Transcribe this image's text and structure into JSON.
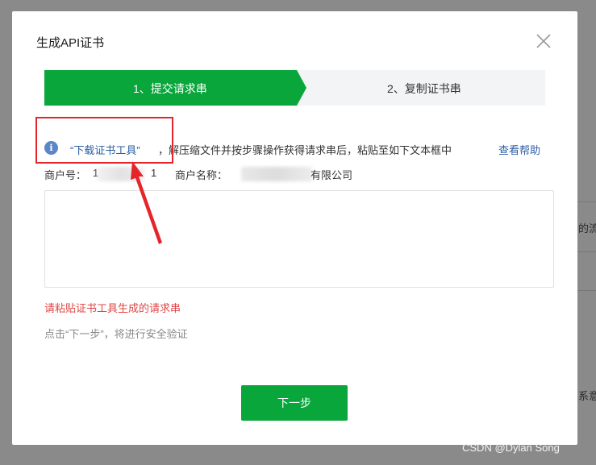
{
  "modal": {
    "title": "生成API证书",
    "steps": [
      {
        "label": "1、提交请求串",
        "active": true
      },
      {
        "label": "2、复制证书串",
        "active": false
      }
    ],
    "info": {
      "icon": "info-icon",
      "link_text": "“下载证书工具”",
      "text": "，解压缩文件并按步骤操作获得请求串后，粘贴至如下文本框中",
      "help_link": "查看帮助"
    },
    "merchant": {
      "id_label": "商户号：",
      "id_prefix": "1",
      "id_suffix": "1",
      "name_label": "商户名称：",
      "name_suffix": "有限公司"
    },
    "textarea": {
      "value": "",
      "placeholder": ""
    },
    "error": "请粘贴证书工具生成的请求串",
    "hint": "点击“下一步”，将进行安全验证",
    "next_button": "下一步"
  },
  "background": {
    "right_texts": [
      "的流",
      "系意"
    ]
  },
  "watermark": "CSDN @Dylan  Song",
  "colors": {
    "primary": "#09a63b",
    "link": "#2b5fa5",
    "error": "#e04444",
    "annotation": "#e5252a"
  }
}
